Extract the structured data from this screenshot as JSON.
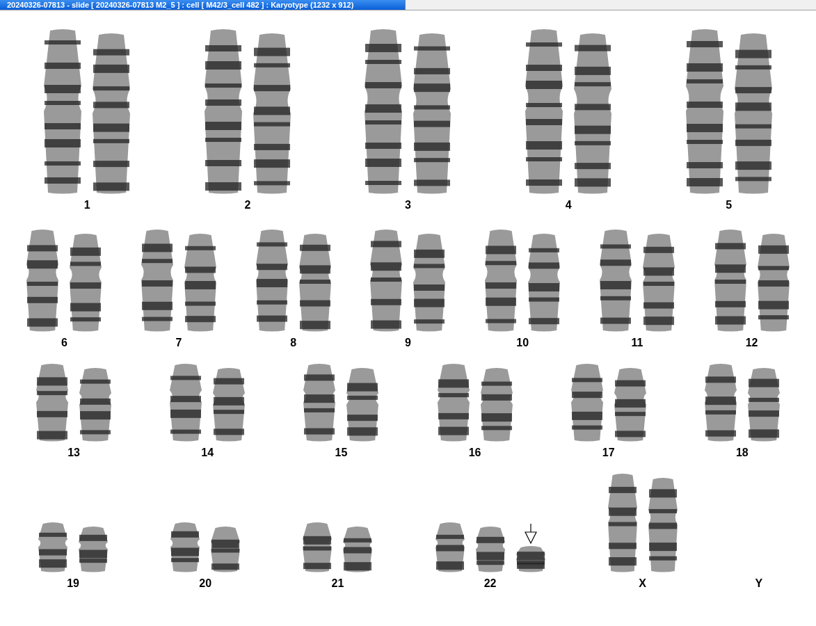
{
  "window": {
    "title": "20240326-07813 - slide [ 20240326-07813 M2_5 ] : cell [ M42/3_cell 482 ] : Karyotype  (1232 x 912)"
  },
  "rows": [
    {
      "groups": [
        {
          "label": "1",
          "kind": "autosome",
          "copies": [
            {
              "marked": false
            },
            {
              "marked": false
            }
          ]
        },
        {
          "label": "2",
          "kind": "autosome",
          "copies": [
            {
              "marked": false
            },
            {
              "marked": false
            }
          ]
        },
        {
          "label": "3",
          "kind": "autosome",
          "copies": [
            {
              "marked": false
            },
            {
              "marked": false
            }
          ]
        },
        {
          "label": "4",
          "kind": "autosome",
          "copies": [
            {
              "marked": false
            },
            {
              "marked": false
            }
          ]
        },
        {
          "label": "5",
          "kind": "autosome",
          "copies": [
            {
              "marked": false
            },
            {
              "marked": false
            }
          ]
        }
      ]
    },
    {
      "groups": [
        {
          "label": "6",
          "kind": "autosome",
          "copies": [
            {
              "marked": false
            },
            {
              "marked": false
            }
          ]
        },
        {
          "label": "7",
          "kind": "autosome",
          "copies": [
            {
              "marked": false
            },
            {
              "marked": false
            }
          ]
        },
        {
          "label": "8",
          "kind": "autosome",
          "copies": [
            {
              "marked": false
            },
            {
              "marked": false
            }
          ]
        },
        {
          "label": "9",
          "kind": "autosome",
          "copies": [
            {
              "marked": false
            },
            {
              "marked": false
            }
          ]
        },
        {
          "label": "10",
          "kind": "autosome",
          "copies": [
            {
              "marked": false
            },
            {
              "marked": false
            }
          ]
        },
        {
          "label": "11",
          "kind": "autosome",
          "copies": [
            {
              "marked": false
            },
            {
              "marked": false
            }
          ]
        },
        {
          "label": "12",
          "kind": "autosome",
          "copies": [
            {
              "marked": false
            },
            {
              "marked": false
            }
          ]
        }
      ]
    },
    {
      "groups": [
        {
          "label": "13",
          "kind": "autosome",
          "copies": [
            {
              "marked": false
            },
            {
              "marked": false
            }
          ]
        },
        {
          "label": "14",
          "kind": "autosome",
          "copies": [
            {
              "marked": false
            },
            {
              "marked": false
            }
          ]
        },
        {
          "label": "15",
          "kind": "autosome",
          "copies": [
            {
              "marked": false
            },
            {
              "marked": false
            }
          ]
        },
        {
          "label": "16",
          "kind": "autosome",
          "copies": [
            {
              "marked": false
            },
            {
              "marked": false
            }
          ]
        },
        {
          "label": "17",
          "kind": "autosome",
          "copies": [
            {
              "marked": false
            },
            {
              "marked": false
            }
          ]
        },
        {
          "label": "18",
          "kind": "autosome",
          "copies": [
            {
              "marked": false
            },
            {
              "marked": false
            }
          ]
        }
      ]
    },
    {
      "groups": [
        {
          "label": "19",
          "kind": "autosome",
          "copies": [
            {
              "marked": false
            },
            {
              "marked": false
            }
          ]
        },
        {
          "label": "20",
          "kind": "autosome",
          "copies": [
            {
              "marked": false
            },
            {
              "marked": false
            }
          ]
        },
        {
          "label": "21",
          "kind": "autosome",
          "copies": [
            {
              "marked": false
            },
            {
              "marked": false
            }
          ]
        },
        {
          "label": "22",
          "kind": "autosome",
          "copies": [
            {
              "marked": false
            },
            {
              "marked": false
            },
            {
              "marked": true
            }
          ]
        },
        {
          "label": "X",
          "kind": "sex",
          "copies": [
            {
              "marked": false
            },
            {
              "marked": false
            }
          ]
        },
        {
          "label": "Y",
          "kind": "sex"
        }
      ]
    }
  ]
}
